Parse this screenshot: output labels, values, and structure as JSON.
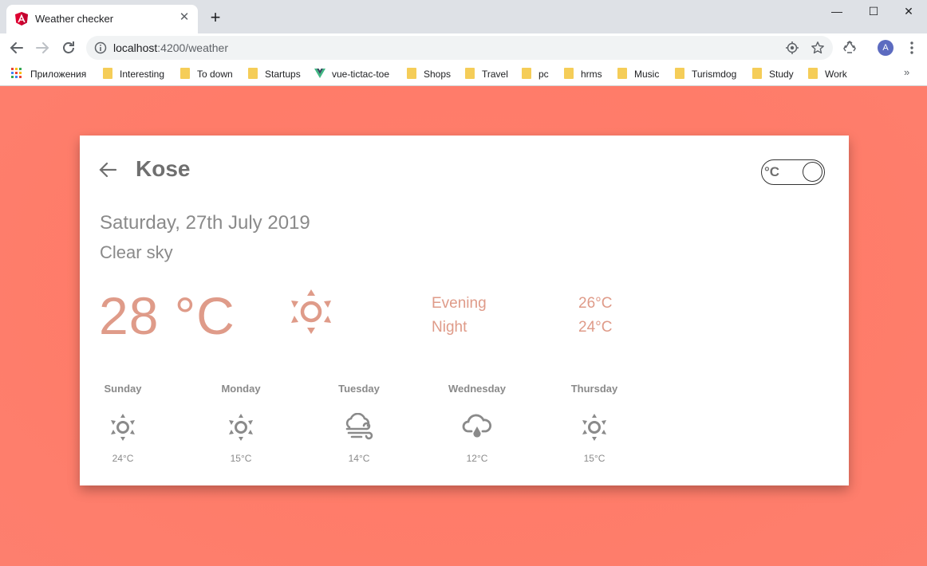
{
  "browser": {
    "tab_title": "Weather checker",
    "tab_close": "✕",
    "new_tab": "+",
    "url_host": "localhost",
    "url_path": ":4200/weather",
    "avatar_letter": "A",
    "window_controls": {
      "minimize": "—",
      "maximize": "☐",
      "close": "✕"
    }
  },
  "bookmarks": {
    "apps_label": "Приложения",
    "items": [
      {
        "label": "Interesting",
        "icon": "folder-icon"
      },
      {
        "label": "To down",
        "icon": "folder-icon"
      },
      {
        "label": "Startups",
        "icon": "folder-icon"
      },
      {
        "label": "vue-tictac-toe",
        "icon": "vue-icon"
      },
      {
        "label": "Shops",
        "icon": "folder-icon"
      },
      {
        "label": "Travel",
        "icon": "folder-icon"
      },
      {
        "label": "pc",
        "icon": "folder-icon"
      },
      {
        "label": "hrms",
        "icon": "folder-icon"
      },
      {
        "label": "Music",
        "icon": "folder-icon"
      },
      {
        "label": "Turismdog",
        "icon": "folder-icon"
      },
      {
        "label": "Study",
        "icon": "folder-icon"
      },
      {
        "label": "Work",
        "icon": "folder-icon"
      }
    ],
    "more": "»"
  },
  "weather": {
    "city": "Kose",
    "unit_toggle": "°C",
    "date": "Saturday, 27th July 2019",
    "description": "Clear sky",
    "current_temp": "28 °C",
    "current_icon": "sun-icon",
    "parts": [
      {
        "label": "Evening",
        "temp": "26°C"
      },
      {
        "label": "Night",
        "temp": "24°C"
      }
    ],
    "forecast": [
      {
        "day": "Sunday",
        "temp": "24°C",
        "icon": "sun-icon"
      },
      {
        "day": "Monday",
        "temp": "15°C",
        "icon": "sun-icon"
      },
      {
        "day": "Tuesday",
        "temp": "14°C",
        "icon": "wind-cloud-icon"
      },
      {
        "day": "Wednesday",
        "temp": "12°C",
        "icon": "rain-cloud-icon"
      },
      {
        "day": "Thursday",
        "temp": "15°C",
        "icon": "sun-icon"
      }
    ]
  },
  "colors": {
    "page_background": "#ff7b6b",
    "accent_temp": "#df9b89",
    "muted_text": "#8a8a8a",
    "city_text": "#6f6f6f"
  }
}
